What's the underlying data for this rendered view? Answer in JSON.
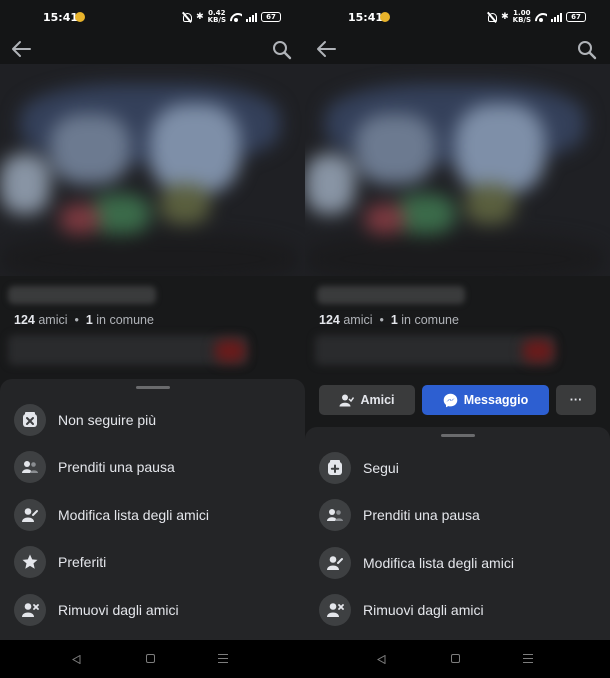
{
  "screens": [
    {
      "status": {
        "time": "15:41",
        "net_speed_top": "0.42",
        "net_speed_bottom": "KB/S",
        "battery": "67"
      },
      "profile": {
        "friend_count": "124",
        "friends_word": "amici",
        "separator": "•",
        "mutual_count": "1",
        "mutual_word": "in comune"
      },
      "menu": [
        {
          "label": "Non seguire più",
          "icon": "unfollow-icon"
        },
        {
          "label": "Prenditi una pausa",
          "icon": "take-break-icon"
        },
        {
          "label": "Modifica lista degli amici",
          "icon": "edit-friend-list-icon"
        },
        {
          "label": "Preferiti",
          "icon": "star-icon"
        },
        {
          "label": "Rimuovi dagli amici",
          "icon": "unfriend-icon"
        }
      ]
    },
    {
      "status": {
        "time": "15:41",
        "net_speed_top": "1.00",
        "net_speed_bottom": "KB/S",
        "battery": "67"
      },
      "profile": {
        "friend_count": "124",
        "friends_word": "amici",
        "separator": "•",
        "mutual_count": "1",
        "mutual_word": "in comune"
      },
      "actions": {
        "friends_button": "Amici",
        "message_button": "Messaggio",
        "more_button": "···"
      },
      "menu": [
        {
          "label": "Segui",
          "icon": "follow-icon"
        },
        {
          "label": "Prenditi una pausa",
          "icon": "take-break-icon"
        },
        {
          "label": "Modifica lista degli amici",
          "icon": "edit-friend-list-icon"
        },
        {
          "label": "Rimuovi dagli amici",
          "icon": "unfriend-icon"
        }
      ]
    }
  ],
  "colors": {
    "background": "#18191a",
    "sheet": "#242527",
    "accent_blue": "#2d5fd1",
    "muted_text": "#b0b3b8"
  }
}
